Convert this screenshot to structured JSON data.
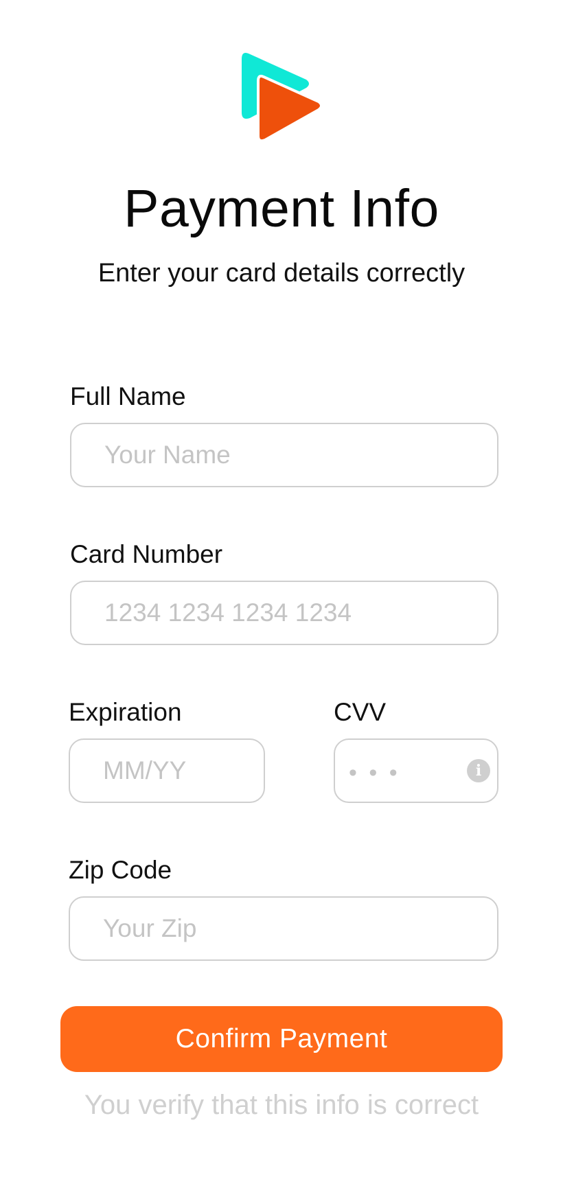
{
  "brand": {
    "logo_icon": "play-triangles-logo-icon",
    "primary_color": "#ff6a1a",
    "secondary_color": "#10e8d6"
  },
  "header": {
    "title": "Payment Info",
    "subtitle": "Enter your card details correctly"
  },
  "form": {
    "full_name": {
      "label": "Full Name",
      "value": "",
      "placeholder": "Your Name"
    },
    "card_number": {
      "label": "Card Number",
      "value": "",
      "placeholder": "1234 1234 1234 1234"
    },
    "expiration": {
      "label": "Expiration",
      "value": "",
      "placeholder": "MM/YY"
    },
    "cvv": {
      "label": "CVV",
      "value": "",
      "placeholder": "• • •",
      "info_icon": "info-icon"
    },
    "zip_code": {
      "label": "Zip Code",
      "value": "",
      "placeholder": "Your Zip"
    }
  },
  "actions": {
    "confirm_label": "Confirm Payment",
    "confirm_color": "#ff6a1a"
  },
  "footer": {
    "note": "You verify that this info is correct"
  }
}
